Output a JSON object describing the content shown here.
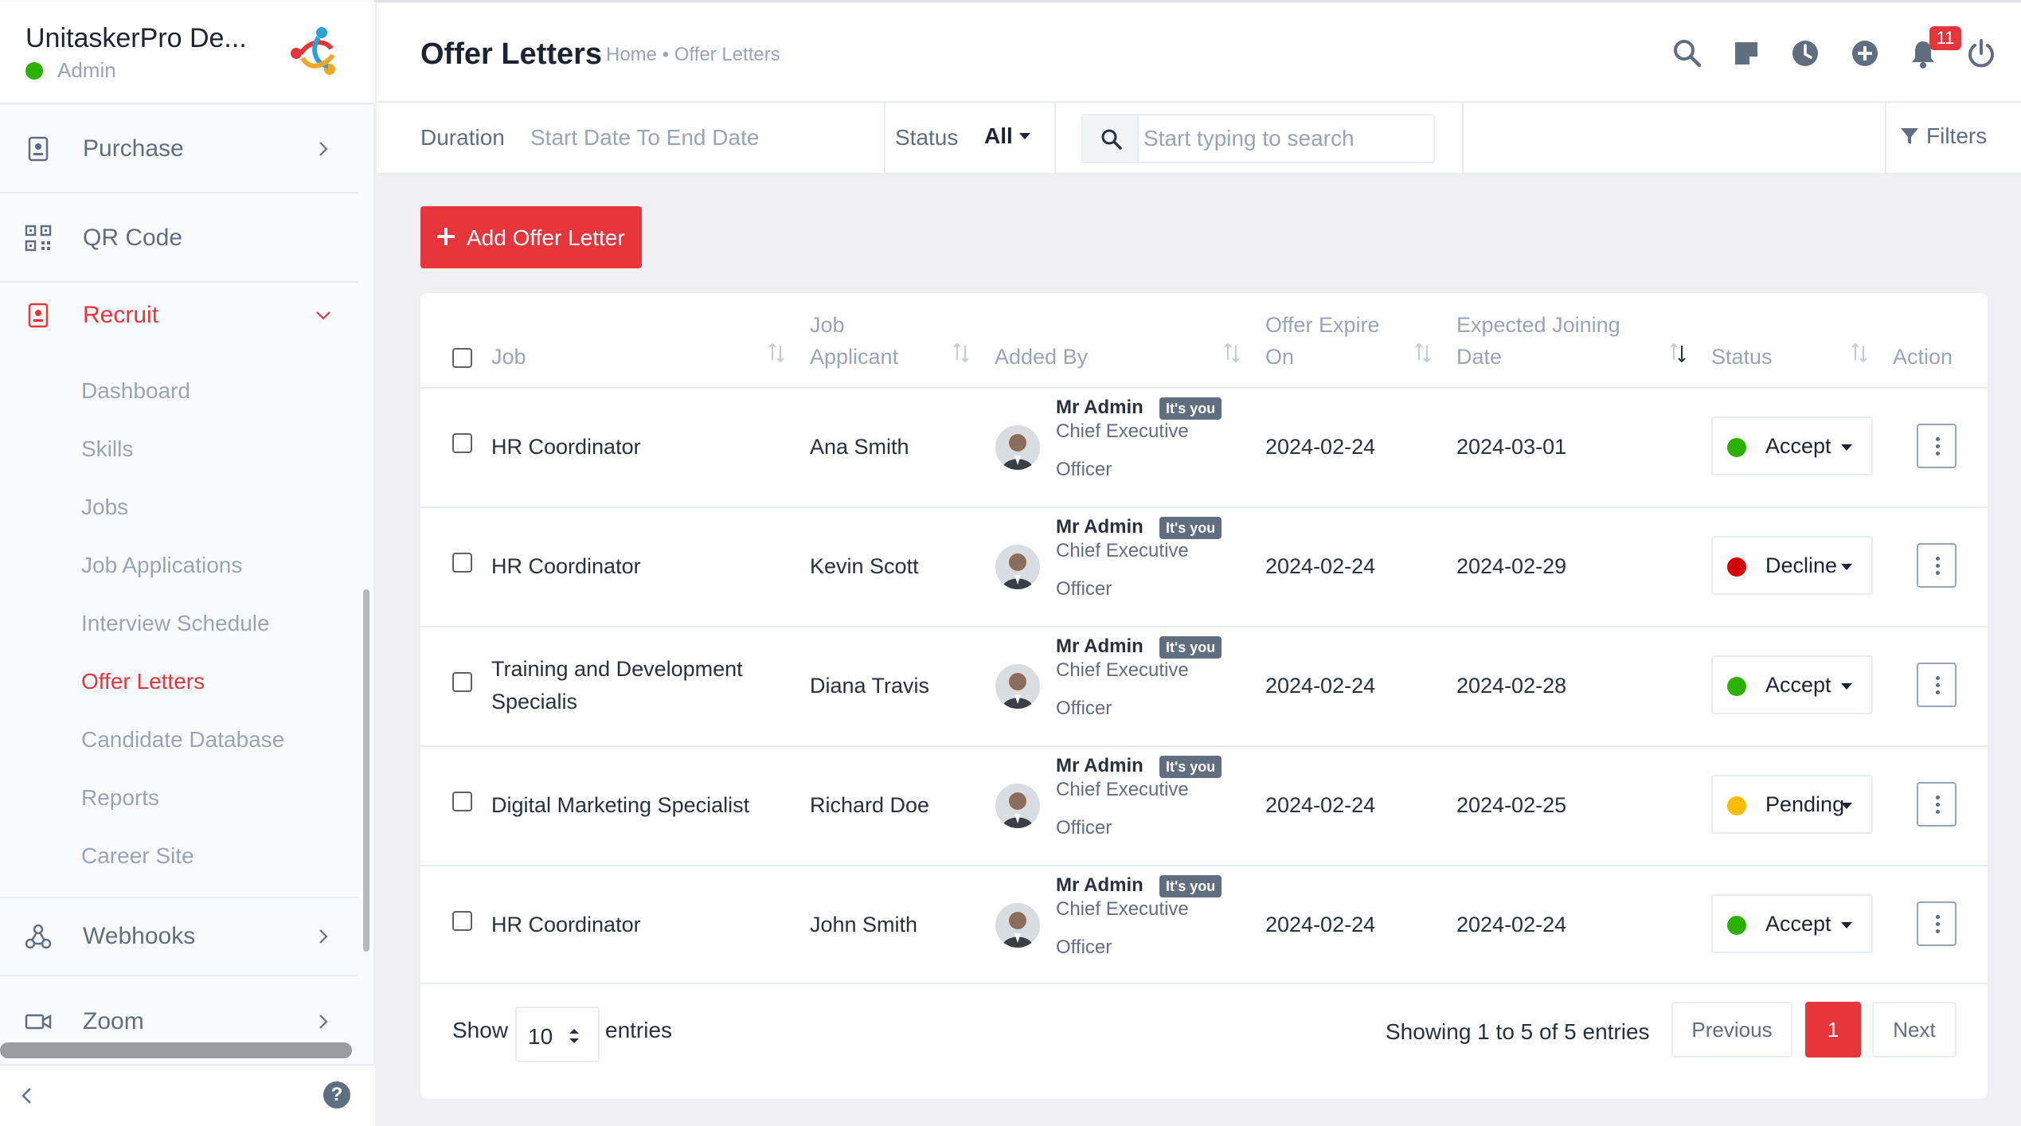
{
  "sidebar": {
    "company": "UnitaskerPro De...",
    "role": "Admin",
    "items": [
      {
        "label": "Purchase"
      },
      {
        "label": "QR Code"
      },
      {
        "label": "Recruit"
      },
      {
        "label": "Webhooks"
      },
      {
        "label": "Zoom"
      }
    ],
    "recruit_sub": [
      {
        "label": "Dashboard"
      },
      {
        "label": "Skills"
      },
      {
        "label": "Jobs"
      },
      {
        "label": "Job Applications"
      },
      {
        "label": "Interview Schedule"
      },
      {
        "label": "Offer Letters"
      },
      {
        "label": "Candidate Database"
      },
      {
        "label": "Reports"
      },
      {
        "label": "Career Site"
      }
    ],
    "help_glyph": "?"
  },
  "header": {
    "title": "Offer Letters",
    "breadcrumb": "Home • Offer Letters",
    "notification_count": "11",
    "icons": [
      "search-icon",
      "sticky-note-icon",
      "clock-icon",
      "plus-circle-icon",
      "bell-icon",
      "power-icon"
    ]
  },
  "filters": {
    "duration_label": "Duration",
    "duration_value": "Start Date To End Date",
    "status_label": "Status",
    "status_value": "All",
    "search_placeholder": "Start typing to search",
    "filters_label": "Filters"
  },
  "add_button": {
    "label": "Add Offer Letter"
  },
  "table": {
    "headers": {
      "job": "Job",
      "applicant_1": "Job",
      "applicant_2": "Applicant",
      "added_by": "Added By",
      "expire_1": "Offer Expire",
      "expire_2": "On",
      "joining_1": "Expected Joining",
      "joining_2": "Date",
      "status": "Status",
      "action": "Action"
    },
    "rows": [
      {
        "job": "HR Coordinator",
        "applicant": "Ana Smith",
        "adder": "Mr Admin",
        "badge": "It's you",
        "role_1": "Chief Executive",
        "role_2": "Officer",
        "expire": "2024-02-24",
        "joining": "2024-03-01",
        "status": "Accept",
        "status_color": "#2cb100"
      },
      {
        "job": "HR Coordinator",
        "applicant": "Kevin Scott",
        "adder": "Mr Admin",
        "badge": "It's you",
        "role_1": "Chief Executive",
        "role_2": "Officer",
        "expire": "2024-02-24",
        "joining": "2024-02-29",
        "status": "Decline",
        "status_color": "#d30000"
      },
      {
        "job_1": "Training and Development",
        "job_2": "Specialis",
        "applicant": "Diana Travis",
        "adder": "Mr Admin",
        "badge": "It's you",
        "role_1": "Chief Executive",
        "role_2": "Officer",
        "expire": "2024-02-24",
        "joining": "2024-02-28",
        "status": "Accept",
        "status_color": "#2cb100"
      },
      {
        "job": "Digital Marketing Specialist",
        "applicant": "Richard Doe",
        "adder": "Mr Admin",
        "badge": "It's you",
        "role_1": "Chief Executive",
        "role_2": "Officer",
        "expire": "2024-02-24",
        "joining": "2024-02-25",
        "status": "Pending",
        "status_color": "#fcbd01"
      },
      {
        "job": "HR Coordinator",
        "applicant": "John Smith",
        "adder": "Mr Admin",
        "badge": "It's you",
        "role_1": "Chief Executive",
        "role_2": "Officer",
        "expire": "2024-02-24",
        "joining": "2024-02-24",
        "status": "Accept",
        "status_color": "#2cb100"
      }
    ]
  },
  "footer": {
    "show_label": "Show",
    "entries_value": "10",
    "entries_label": "entries",
    "showing": "Showing 1 to 5 of 5 entries",
    "prev": "Previous",
    "page": "1",
    "next": "Next"
  },
  "colors": {
    "accent": "#e7363b",
    "online": "#2cb100"
  }
}
